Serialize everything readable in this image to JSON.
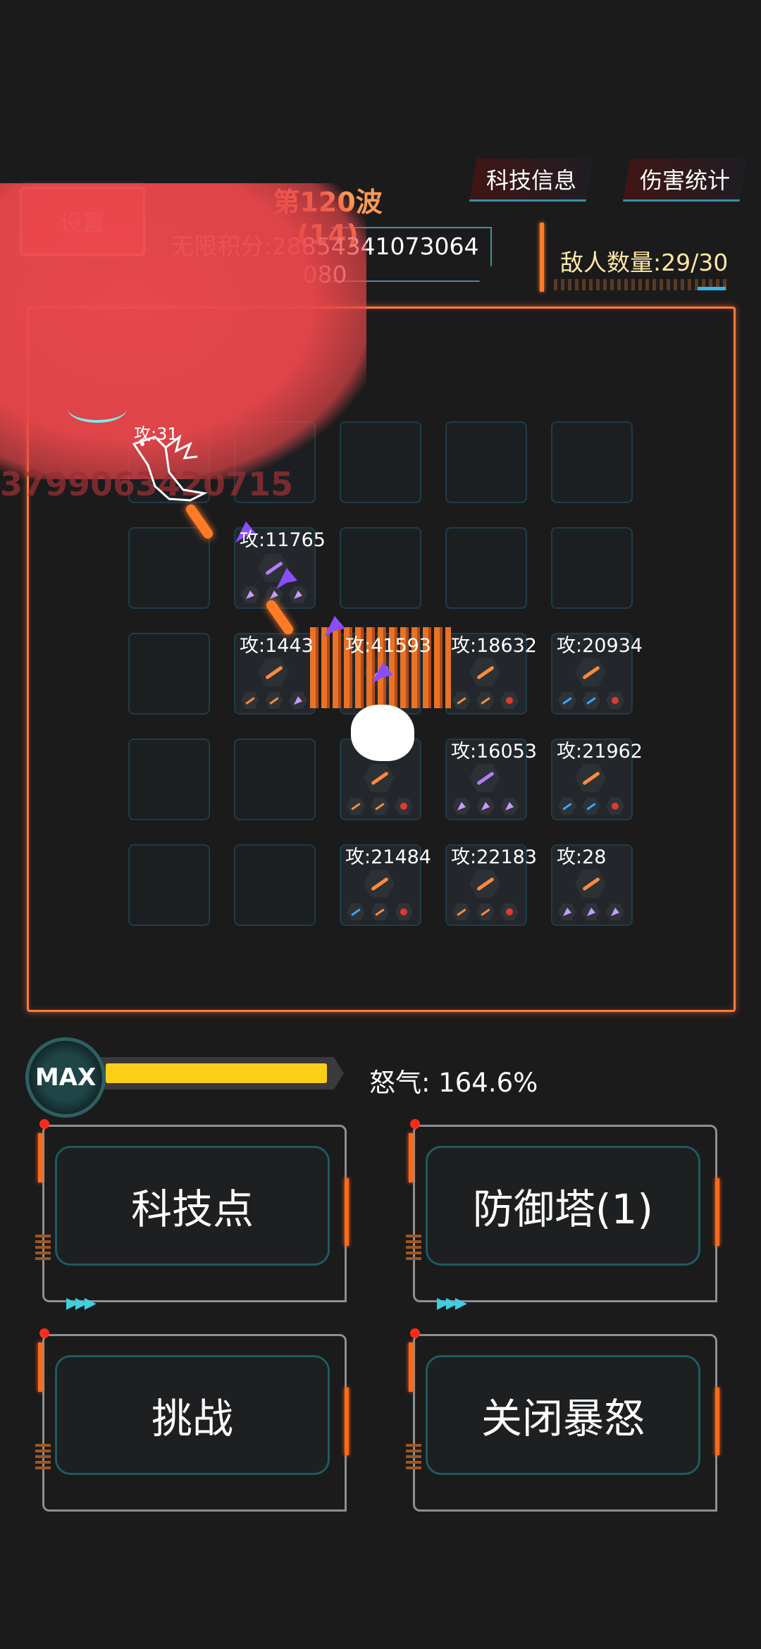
{
  "header": {
    "settings_label": "设置",
    "wave_title": "第120波(14)",
    "score_line1": "无限积分:28854341073064",
    "score_line2": "080",
    "tab_tech_info": "科技信息",
    "tab_damage_stats": "伤害统计",
    "enemy_count": "敌人数量:29/30"
  },
  "arena": {
    "dragon_attack": "攻:31",
    "overlay_number": "3799063420715",
    "towers": [
      {
        "label": "攻:11765"
      },
      {
        "label": "攻:1443"
      },
      {
        "label": "攻:41593"
      },
      {
        "label": "攻:18632"
      },
      {
        "label": "攻:20934"
      },
      {
        "label": "攻:16053"
      },
      {
        "label": "攻:21962"
      },
      {
        "label": "攻:21484"
      },
      {
        "label": "攻:22183"
      },
      {
        "label": "攻:28"
      }
    ]
  },
  "rage": {
    "badge": "MAX",
    "text": "怒气: 164.6%",
    "fill_fraction": 1.0,
    "fill_color": "#fbcf16"
  },
  "actions": {
    "tech_points": "科技点",
    "defense_tower": "防御塔(1)",
    "challenge": "挑战",
    "close_rage": "关闭暴怒"
  },
  "colors": {
    "accent_orange": "#ff7a3a",
    "settings_red": "#e03a3e",
    "wave_orange": "#ff9a52",
    "enemy_count_yellow": "#ffe8a3",
    "cyan": "#56c2c9"
  }
}
